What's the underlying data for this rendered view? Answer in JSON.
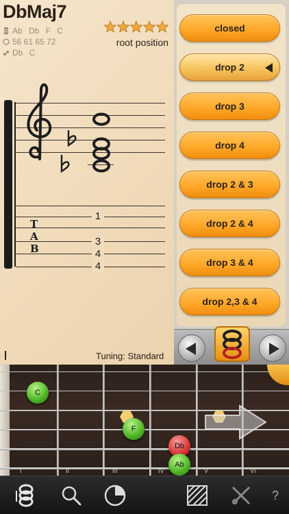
{
  "chord": {
    "name": "DbMaj7",
    "notes": "Ab  Db  F  C",
    "midi": "56 61 65 72",
    "inversion_notes": "Db  C",
    "rating_stars": 5,
    "position_label": "root position"
  },
  "tab": {
    "letters": [
      "T",
      "A",
      "B"
    ],
    "frets": [
      "1",
      "3",
      "4",
      "4"
    ]
  },
  "tuning_label": "Tuning: Standard",
  "voicings": [
    {
      "label": "closed",
      "selected": false
    },
    {
      "label": "drop 2",
      "selected": true
    },
    {
      "label": "drop 3",
      "selected": false
    },
    {
      "label": "drop 4",
      "selected": false
    },
    {
      "label": "drop 2 & 3",
      "selected": false
    },
    {
      "label": "drop 2 & 4",
      "selected": false
    },
    {
      "label": "drop 3 & 4",
      "selected": false
    },
    {
      "label": "drop 2,3 & 4",
      "selected": false
    }
  ],
  "fretboard": {
    "fret_numbers": [
      "I",
      "II",
      "III",
      "IV",
      "V",
      "VI"
    ],
    "dots": [
      "C",
      "F",
      "Db",
      "Ab"
    ]
  },
  "toolbar": {
    "help_label": "?"
  },
  "colors": {
    "accent": "#ffa92b",
    "paper": "#f1dcbc",
    "dot_green": "#4cb324",
    "dot_red": "#d83434"
  }
}
